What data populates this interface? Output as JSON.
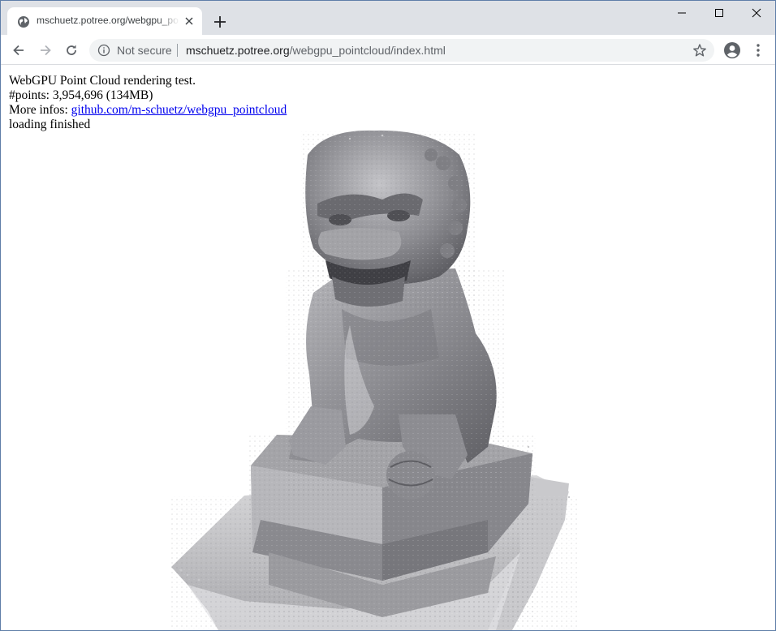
{
  "browser": {
    "tab_title": "mschuetz.potree.org/webgpu_pointcloud/index.html",
    "security_label": "Not secure",
    "url_host": "mschuetz.potree.org",
    "url_path": "/webgpu_pointcloud/index.html"
  },
  "page": {
    "line1": "WebGPU Point Cloud rendering test.",
    "line2": "#points: 3,954,696 (134MB)",
    "more_infos_label": "More infos: ",
    "more_infos_link": "github.com/m-schuetz/webgpu_pointcloud",
    "status": "loading finished"
  },
  "icons": [
    "globe-icon",
    "close-icon",
    "plus-icon",
    "minimize-icon",
    "maximize-icon",
    "window-close-icon",
    "back-arrow-icon",
    "forward-arrow-icon",
    "reload-icon",
    "info-icon",
    "star-icon",
    "profile-icon",
    "kebab-menu-icon"
  ],
  "colors": {
    "tabstrip": "#dee1e6",
    "omnibox": "#f1f3f4",
    "link": "#0000ee",
    "stone": "#8a8a8e"
  }
}
